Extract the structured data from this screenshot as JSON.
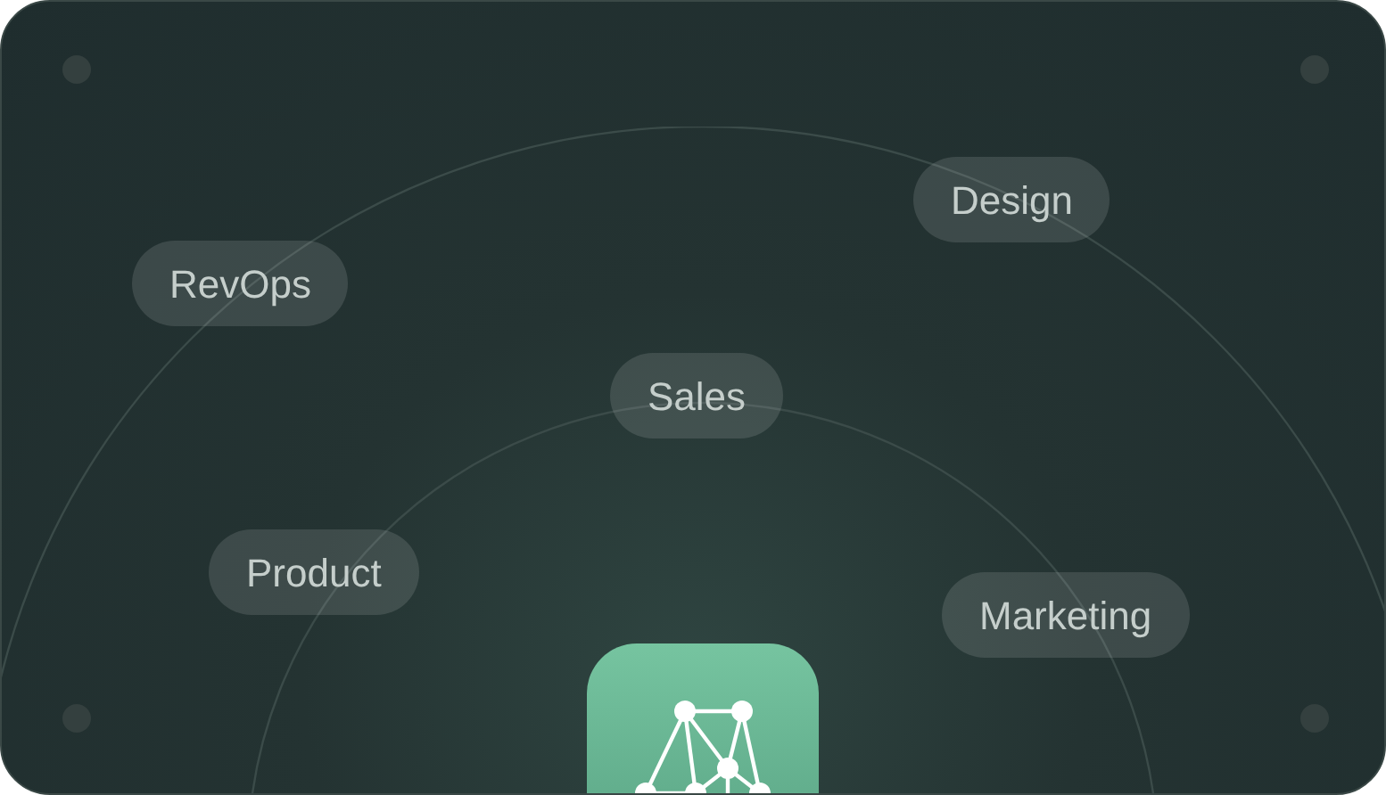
{
  "tags": [
    {
      "label": "RevOps"
    },
    {
      "label": "Design"
    },
    {
      "label": "Sales"
    },
    {
      "label": "Product"
    },
    {
      "label": "Marketing"
    }
  ]
}
